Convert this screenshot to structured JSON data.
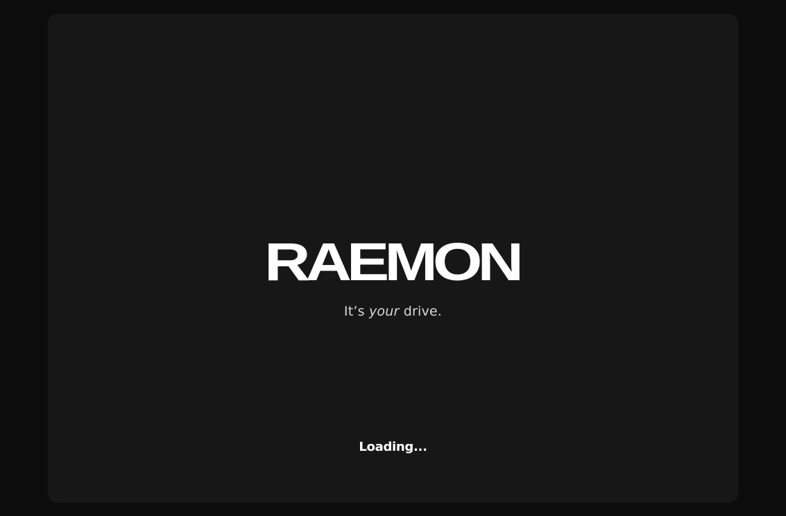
{
  "splash": {
    "brand": "RAEMON",
    "tagline": {
      "prefix": "It’s ",
      "emphasis": "your",
      "suffix": " drive."
    },
    "status": "Loading..."
  }
}
